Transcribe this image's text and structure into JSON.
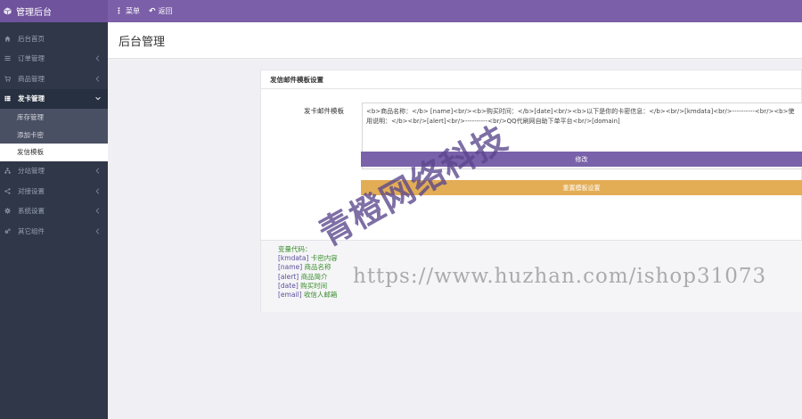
{
  "topbar": {
    "brand": "管理后台",
    "nav": [
      {
        "icon": "menu-icon",
        "label": "菜单"
      },
      {
        "icon": "back-arrow-icon",
        "label": "返回"
      }
    ],
    "accent": "#7b5fa8"
  },
  "sidebar": {
    "items": [
      {
        "icon": "home-icon",
        "label": "后台首页"
      },
      {
        "icon": "list-icon",
        "label": "订单管理"
      },
      {
        "icon": "cart-icon",
        "label": "商品管理"
      },
      {
        "icon": "grid-icon",
        "label": "发卡管理",
        "expanded": true,
        "children": [
          {
            "label": "库存管理"
          },
          {
            "label": "添加卡密"
          },
          {
            "label": "发信模板",
            "active": true
          }
        ]
      },
      {
        "icon": "sitemap-icon",
        "label": "分站管理"
      },
      {
        "icon": "share-icon",
        "label": "对接设置"
      },
      {
        "icon": "gear-icon",
        "label": "系统设置"
      },
      {
        "icon": "gears-icon",
        "label": "其它组件"
      }
    ]
  },
  "page": {
    "title": "后台管理"
  },
  "panel": {
    "title": "发信邮件模板设置",
    "field_label": "发卡邮件模板",
    "template_value": "<b>商品名称：</b> [name]<br/><b>购买时间：</b>[date]<br/><b>以下是你的卡密信息：</b><br/>[kmdata]<br/>----------<br/><b>使用说明：</b><br/>[alert]<br/>----------<br/>QQ代刷网自助下单平台<br/>[domain]",
    "btn_edit": "修改",
    "btn_reset": "重置模板设置",
    "btn_edit_color": "#7a62ab",
    "btn_reset_color": "#e3ad55"
  },
  "vars": {
    "title": "变量代码：",
    "list": [
      {
        "key": "[kmdata]",
        "desc": "卡密内容"
      },
      {
        "key": "[name]",
        "desc": "商品名称"
      },
      {
        "key": "[alert]",
        "desc": "商品简介"
      },
      {
        "key": "[date]",
        "desc": "购买时间"
      },
      {
        "key": "[email]",
        "desc": "收信人邮箱"
      }
    ]
  },
  "watermark": {
    "cn": "青橙网络科技",
    "url": "https://www.huzhan.com/ishop31073"
  }
}
